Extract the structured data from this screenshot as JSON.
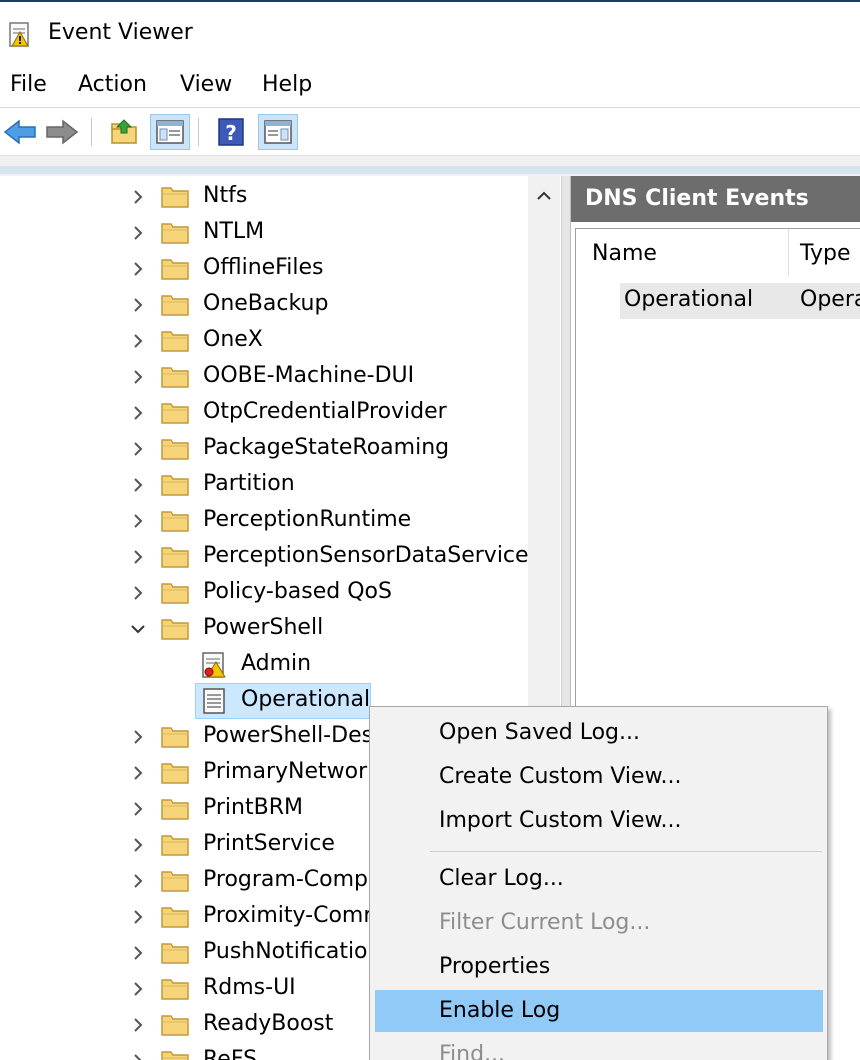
{
  "window": {
    "title": "Event Viewer"
  },
  "menubar": {
    "items": [
      "File",
      "Action",
      "View",
      "Help"
    ]
  },
  "toolbar": {
    "buttons": [
      "back-arrow-icon",
      "forward-arrow-icon",
      "up-folder-icon",
      "show-hide-console-tree-icon",
      "help-icon",
      "show-hide-action-pane-icon"
    ]
  },
  "tree": {
    "items": [
      {
        "label": "Ntfs",
        "type": "folder",
        "expanded": false
      },
      {
        "label": "NTLM",
        "type": "folder",
        "expanded": false
      },
      {
        "label": "OfflineFiles",
        "type": "folder",
        "expanded": false
      },
      {
        "label": "OneBackup",
        "type": "folder",
        "expanded": false
      },
      {
        "label": "OneX",
        "type": "folder",
        "expanded": false
      },
      {
        "label": "OOBE-Machine-DUI",
        "type": "folder",
        "expanded": false
      },
      {
        "label": "OtpCredentialProvider",
        "type": "folder",
        "expanded": false
      },
      {
        "label": "PackageStateRoaming",
        "type": "folder",
        "expanded": false
      },
      {
        "label": "Partition",
        "type": "folder",
        "expanded": false
      },
      {
        "label": "PerceptionRuntime",
        "type": "folder",
        "expanded": false
      },
      {
        "label": "PerceptionSensorDataService",
        "type": "folder",
        "expanded": false
      },
      {
        "label": "Policy-based QoS",
        "type": "folder",
        "expanded": false
      },
      {
        "label": "PowerShell",
        "type": "folder",
        "expanded": true
      },
      {
        "label": "Admin",
        "type": "log-admin"
      },
      {
        "label": "Operational",
        "type": "log",
        "selected": true
      },
      {
        "label": "PowerShell-Des",
        "type": "folder",
        "expanded": false
      },
      {
        "label": "PrimaryNetwork",
        "type": "folder",
        "expanded": false
      },
      {
        "label": "PrintBRM",
        "type": "folder",
        "expanded": false
      },
      {
        "label": "PrintService",
        "type": "folder",
        "expanded": false
      },
      {
        "label": "Program-Comp",
        "type": "folder",
        "expanded": false
      },
      {
        "label": "Proximity-Comr",
        "type": "folder",
        "expanded": false
      },
      {
        "label": "PushNotificatio",
        "type": "folder",
        "expanded": false
      },
      {
        "label": "Rdms-UI",
        "type": "folder",
        "expanded": false
      },
      {
        "label": "ReadyBoost",
        "type": "folder",
        "expanded": false
      },
      {
        "label": "ReFS",
        "type": "folder",
        "expanded": false
      }
    ]
  },
  "right_pane": {
    "title": "DNS Client Events",
    "columns": [
      "Name",
      "Type"
    ],
    "rows": [
      {
        "name": "Operational",
        "type": "Opera"
      }
    ]
  },
  "context_menu": {
    "items": [
      {
        "label": "Open Saved Log...",
        "enabled": true
      },
      {
        "label": "Create Custom View...",
        "enabled": true
      },
      {
        "label": "Import Custom View...",
        "enabled": true
      },
      {
        "separator": true
      },
      {
        "label": "Clear Log...",
        "enabled": true
      },
      {
        "label": "Filter Current Log...",
        "enabled": false
      },
      {
        "label": "Properties",
        "enabled": true
      },
      {
        "label": "Enable Log",
        "enabled": true,
        "highlighted": true
      },
      {
        "label": "Find...",
        "enabled": false
      }
    ]
  },
  "colors": {
    "selection": "#cce8ff",
    "menu_highlight": "#91c9f7",
    "header_bg": "#6d6d6d",
    "folder": "#f5d47a"
  }
}
